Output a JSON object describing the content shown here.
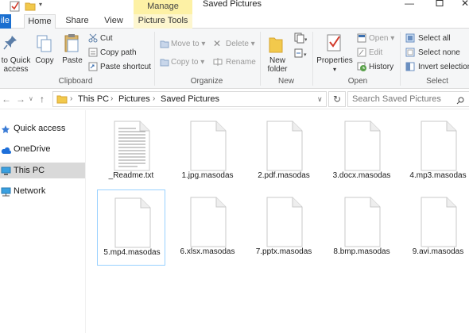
{
  "titlebar": {
    "title": "Saved Pictures",
    "contextual_group": "Manage"
  },
  "tabs": [
    {
      "label": "ile"
    },
    {
      "label": "Home"
    },
    {
      "label": "Share"
    },
    {
      "label": "View"
    },
    {
      "label": "Picture Tools"
    }
  ],
  "ribbon": {
    "clipboard": {
      "pin_label_1": "to Quick",
      "pin_label_2": "access",
      "copy": "Copy",
      "paste": "Paste",
      "cut": "Cut",
      "copy_path": "Copy path",
      "paste_shortcut": "Paste shortcut",
      "group": "Clipboard"
    },
    "organize": {
      "move_to": "Move to",
      "copy_to": "Copy to",
      "delete": "Delete",
      "rename": "Rename",
      "group": "Organize"
    },
    "new": {
      "new_folder_1": "New",
      "new_folder_2": "folder",
      "group": "New"
    },
    "open": {
      "properties": "Properties",
      "open": "Open",
      "edit": "Edit",
      "history": "History",
      "group": "Open"
    },
    "select": {
      "select_all": "Select all",
      "select_none": "Select none",
      "invert_selection": "Invert selection",
      "group": "Select"
    }
  },
  "address": {
    "crumbs": [
      "This PC",
      "Pictures",
      "Saved Pictures"
    ],
    "search_placeholder": "Search Saved Pictures"
  },
  "nav": [
    {
      "label": "Quick access"
    },
    {
      "label": "OneDrive"
    },
    {
      "label": "This PC"
    },
    {
      "label": "Network"
    }
  ],
  "files": [
    {
      "name": "_Readme.txt"
    },
    {
      "name": "1.jpg.masodas"
    },
    {
      "name": "2.pdf.masodas"
    },
    {
      "name": "3.docx.masodas"
    },
    {
      "name": "4.mp3.masodas"
    },
    {
      "name": "5.mp4.masodas"
    },
    {
      "name": "6.xlsx.masodas"
    },
    {
      "name": "7.pptx.masodas"
    },
    {
      "name": "8.bmp.masodas"
    },
    {
      "name": "9.avi.masodas"
    }
  ],
  "colors": {
    "file_tab": "#1a6fd0",
    "manage": "#fdf1a5",
    "selection": "#99d1ff",
    "nav_selected": "#d9d9d9"
  }
}
